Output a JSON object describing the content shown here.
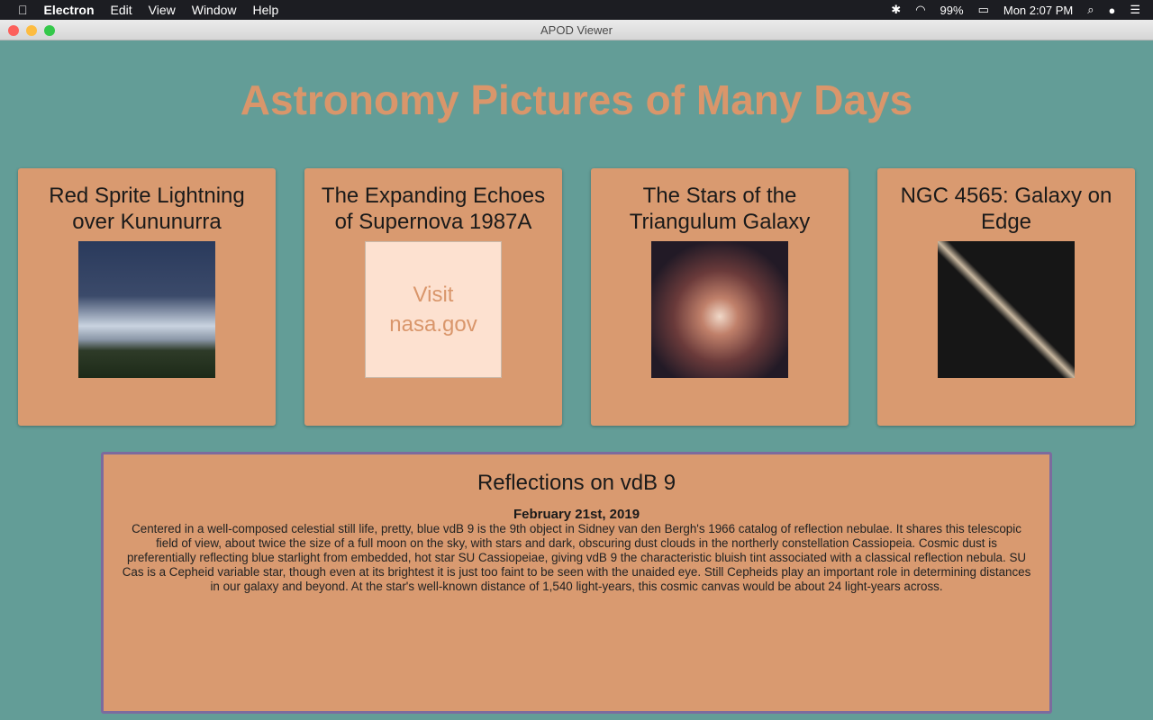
{
  "menubar": {
    "app": "Electron",
    "items": [
      "Edit",
      "View",
      "Window",
      "Help"
    ],
    "battery": "99%",
    "clock": "Mon 2:07 PM"
  },
  "window": {
    "title": "APOD Viewer"
  },
  "page": {
    "heading": "Astronomy Pictures of Many Days"
  },
  "cards": [
    {
      "title": "Red Sprite Lightning over Kununurra"
    },
    {
      "title": "The Expanding Echoes of Supernova 1987A",
      "alt": "Visit nasa.gov"
    },
    {
      "title": "The Stars of the Triangulum Galaxy"
    },
    {
      "title": "NGC 4565: Galaxy on Edge"
    }
  ],
  "detail": {
    "title": "Reflections on vdB 9",
    "date": "February 21st, 2019",
    "explanation": "Centered in a well-composed celestial still life, pretty, blue vdB 9 is the 9th object in Sidney van den Bergh's 1966 catalog of reflection nebulae. It shares this telescopic field of view, about twice the size of a full moon on the sky, with stars and dark, obscuring dust clouds in the northerly constellation Cassiopeia. Cosmic dust is preferentially reflecting blue starlight from embedded, hot star SU Cassiopeiae, giving vdB 9 the characteristic bluish tint associated with a classical reflection nebula. SU Cas is a Cepheid variable star, though even at its brightest it is just too faint to be seen with the unaided eye. Still Cepheids play an important role in determining distances in our galaxy and beyond. At the star's well-known distance of 1,540 light-years, this cosmic canvas would be about 24 light-years across."
  }
}
